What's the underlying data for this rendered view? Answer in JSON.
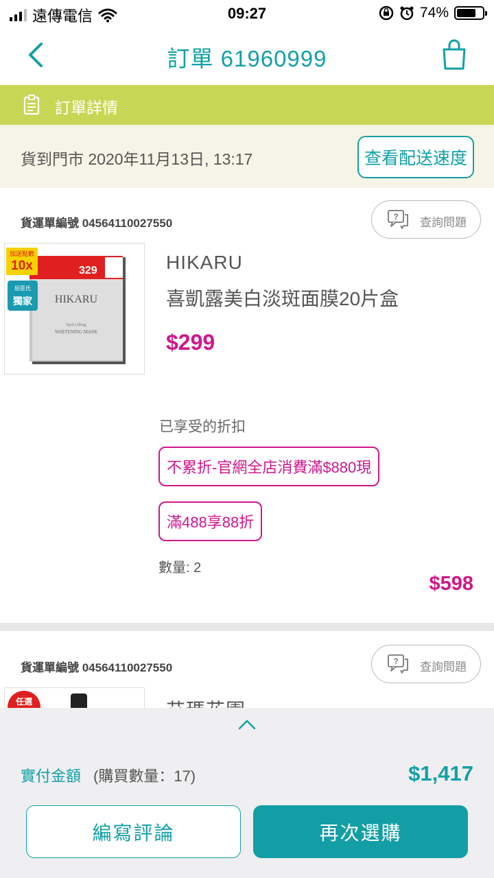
{
  "status_bar": {
    "carrier": "遠傳電信",
    "time": "09:27",
    "battery": "74%",
    "battery_level": 0.74
  },
  "header": {
    "title": "訂單 61960999",
    "back_icon": "chevron-left-icon",
    "bag_icon": "shopping-bag-icon"
  },
  "section": {
    "label": "訂單詳情",
    "icon": "clipboard-icon"
  },
  "delivery": {
    "text": "貨到門市 2020年11月13日, 13:17",
    "track_button": "查看配送速度"
  },
  "items": [
    {
      "shipment_label": "貨運單編號 04564110027550",
      "ask_button": "查詢問題",
      "image_badges": {
        "top_left": "加送點數",
        "multiplier": "10x",
        "exclusive_small": "屈臣氏",
        "exclusive": "獨家",
        "promo": "329",
        "brand": "HIKARU",
        "line1": "Spot Lifting",
        "line2": "WHITENING MASK"
      },
      "brand": "HIKARU",
      "name": "喜凱露美白淡斑面膜20片盒",
      "price": "$299",
      "discount_title": "已享受的折扣",
      "discounts": [
        "不累折-官網全店消費滿$880現",
        "滿488享88折"
      ],
      "quantity": "數量: 2",
      "total": "$598"
    },
    {
      "shipment_label": "貨運單編號 04564110027550",
      "ask_button": "查詢問題",
      "image_badge": "任選",
      "brand": "艾瑪花園"
    }
  ],
  "summary": {
    "paid_label": "實付金額",
    "count": "(購買數量：17)",
    "total": "$1,417",
    "review_button": "編寫評論",
    "rebuy_button": "再次選購"
  },
  "colors": {
    "teal": "#12a0a6",
    "magenta": "#d0178c",
    "lime": "#c9d655"
  }
}
